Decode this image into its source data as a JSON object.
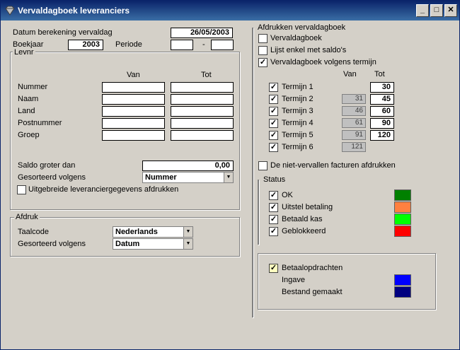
{
  "window": {
    "title": "Vervaldagboek leveranciers"
  },
  "left": {
    "date_label": "Datum berekening vervaldag",
    "date_value": "26/05/2003",
    "year_label": "Boekjaar",
    "year_value": "2003",
    "period_label": "Periode",
    "period_sep": "-",
    "levnr": {
      "title": "Levnr",
      "col_van": "Van",
      "col_tot": "Tot",
      "rows": [
        "Nummer",
        "Naam",
        "Land",
        "Postnummer",
        "Groep"
      ]
    },
    "saldo_label": "Saldo groter dan",
    "saldo_value": "0,00",
    "sort_label": "Gesorteerd volgens",
    "sort_value": "Nummer",
    "extended_label": "Uitgebreide leveranciergegevens afdrukken",
    "afdruk": {
      "title": "Afdruk",
      "lang_label": "Taalcode",
      "lang_value": "Nederlands",
      "sort_label": "Gesorteerd volgens",
      "sort_value": "Datum"
    }
  },
  "right": {
    "title": "Afdrukken vervaldagboek",
    "opt1": "Vervaldagboek",
    "opt2": "Lijst enkel met saldo's",
    "opt3": "Vervaldagboek volgens termijn",
    "col_van": "Van",
    "col_tot": "Tot",
    "terms": [
      {
        "label": "Termijn 1",
        "van": "",
        "tot": "30"
      },
      {
        "label": "Termijn 2",
        "van": "31",
        "tot": "45"
      },
      {
        "label": "Termijn 3",
        "van": "46",
        "tot": "60"
      },
      {
        "label": "Termijn 4",
        "van": "61",
        "tot": "90"
      },
      {
        "label": "Termijn 5",
        "van": "91",
        "tot": "120"
      },
      {
        "label": "Termijn 6",
        "van": "121",
        "tot": ""
      }
    ],
    "nonexpired_label": "De niet-vervallen facturen afdrukken",
    "status": {
      "title": "Status",
      "items": [
        {
          "label": "OK",
          "color": "#008000"
        },
        {
          "label": "Uitstel betaling",
          "color": "#ff8040"
        },
        {
          "label": "Betaald kas",
          "color": "#00ff00"
        },
        {
          "label": "Geblokkeerd",
          "color": "#ff0000"
        }
      ]
    },
    "payment": {
      "label": "Betaalopdrachten",
      "ingave_label": "Ingave",
      "ingave_color": "#0000ff",
      "bestand_label": "Bestand gemaakt",
      "bestand_color": "#000080"
    }
  }
}
